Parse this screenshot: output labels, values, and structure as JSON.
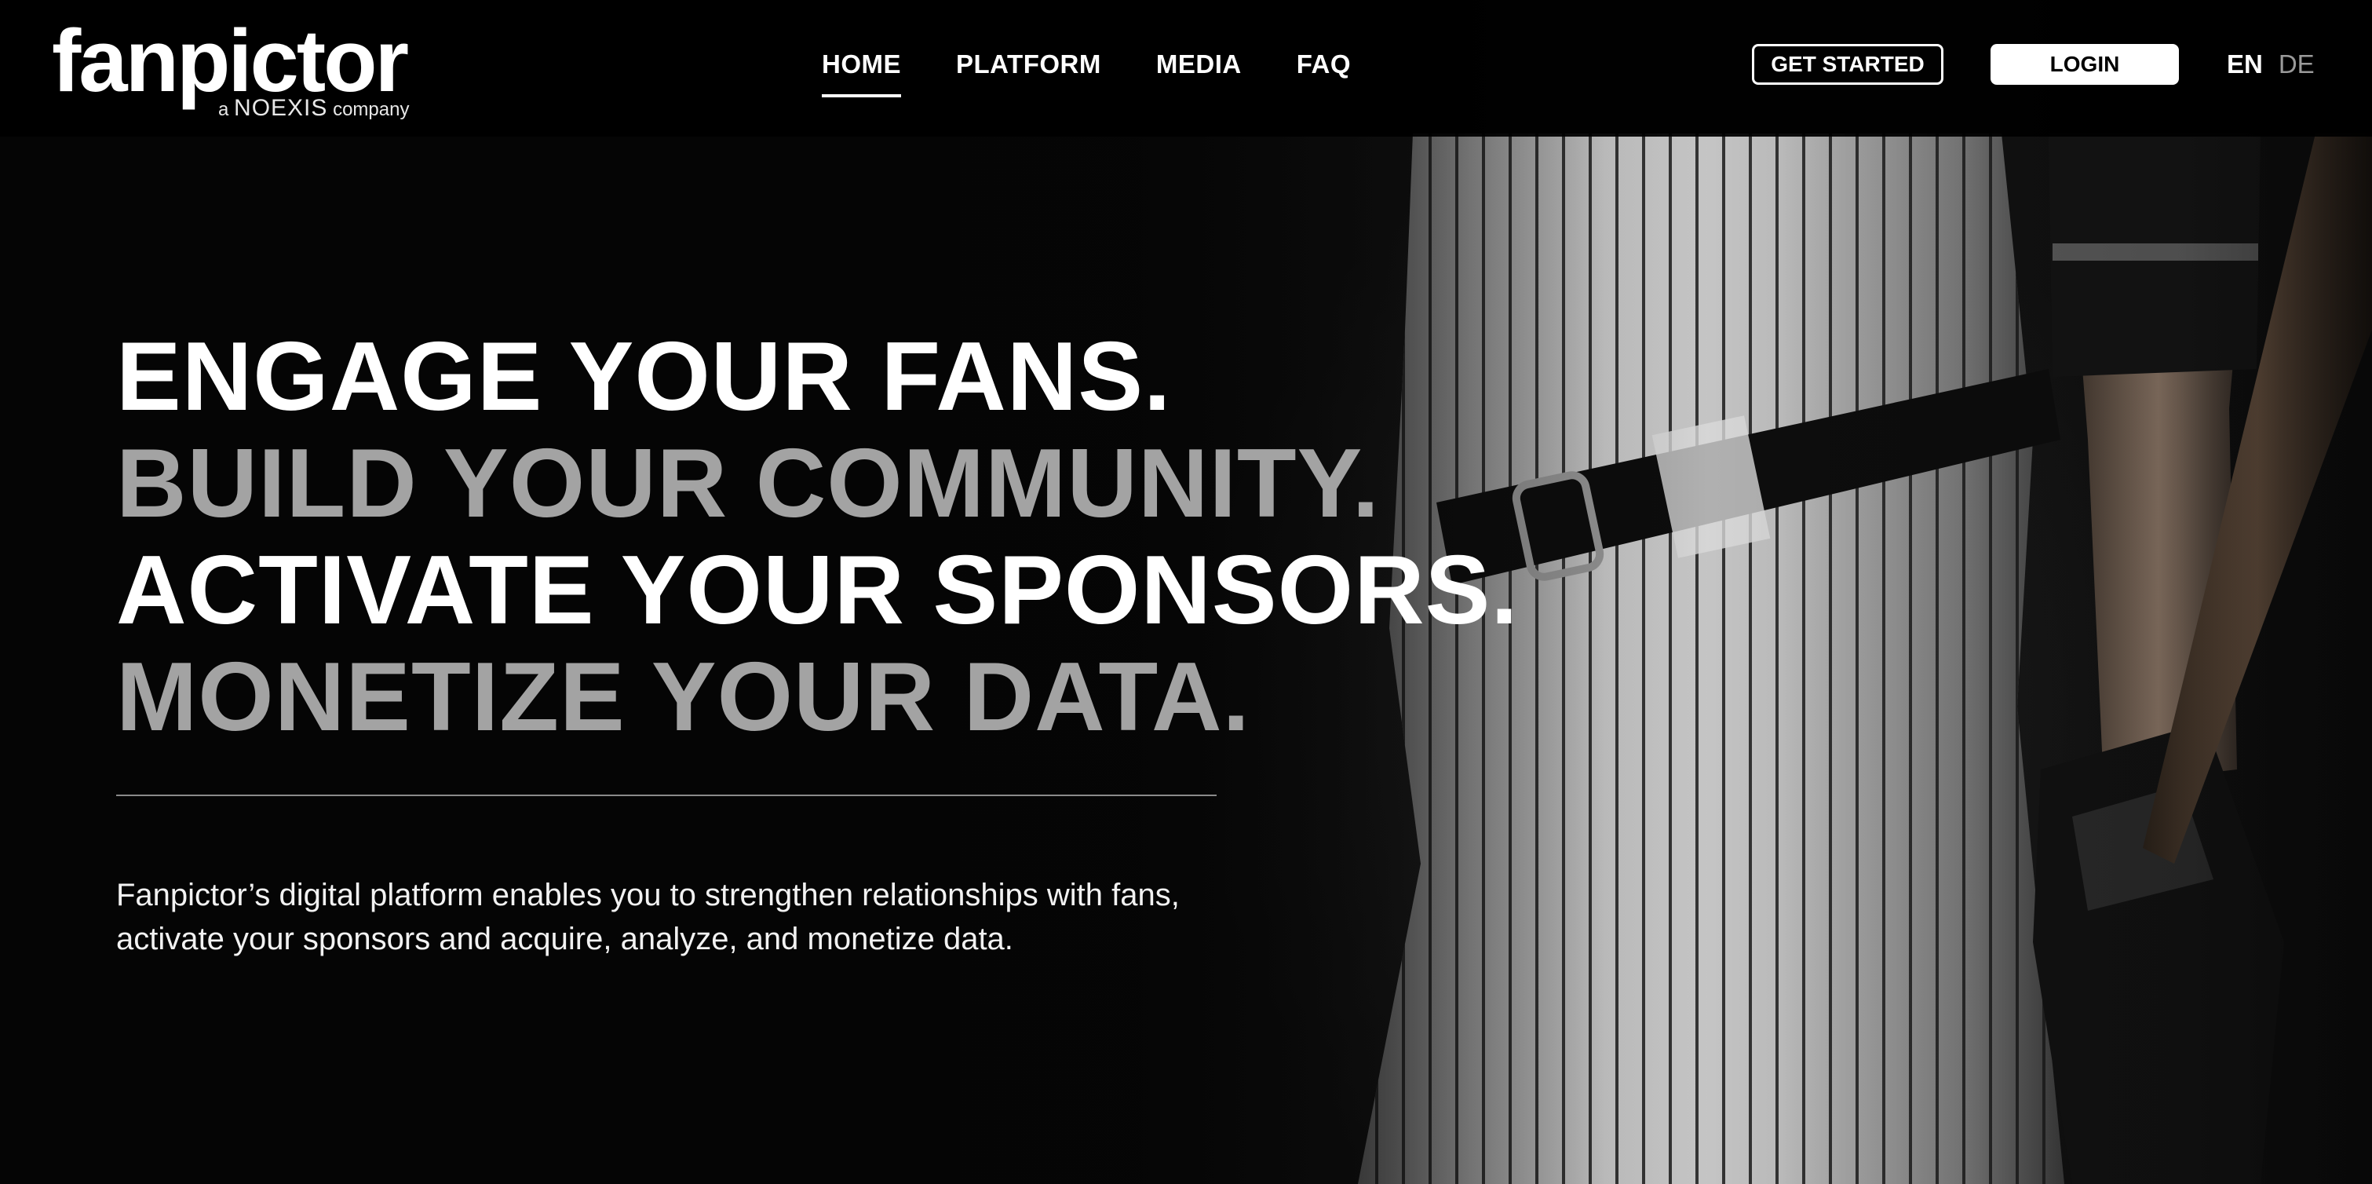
{
  "brand": {
    "logo_text": "fanpictor",
    "tagline_prefix": "a",
    "tagline_brand": "NOEXIS",
    "tagline_suffix": "company"
  },
  "nav": {
    "items": [
      {
        "label": "HOME",
        "active": true
      },
      {
        "label": "PLATFORM",
        "active": false
      },
      {
        "label": "MEDIA",
        "active": false
      },
      {
        "label": "FAQ",
        "active": false
      }
    ]
  },
  "actions": {
    "get_started_label": "GET STARTED",
    "login_label": "LOGIN"
  },
  "language": {
    "options": [
      "EN",
      "DE"
    ],
    "selected": "EN"
  },
  "hero": {
    "lines": [
      "ENGAGE YOUR FANS.",
      "BUILD YOUR COMMUNITY.",
      "ACTIVATE YOUR SPONSORS.",
      "MONETIZE YOUR DATA."
    ],
    "description": "Fanpictor’s digital platform enables you to strengthen relationships with fans, activate your sponsors and acquire, analyze, and monetize data.",
    "background_image": "baseball-player-pinstripe-uniform"
  },
  "colors": {
    "background": "#050505",
    "text_primary": "#ffffff",
    "text_muted": "#a3a3a3",
    "lang_inactive": "#9a9a9a"
  }
}
